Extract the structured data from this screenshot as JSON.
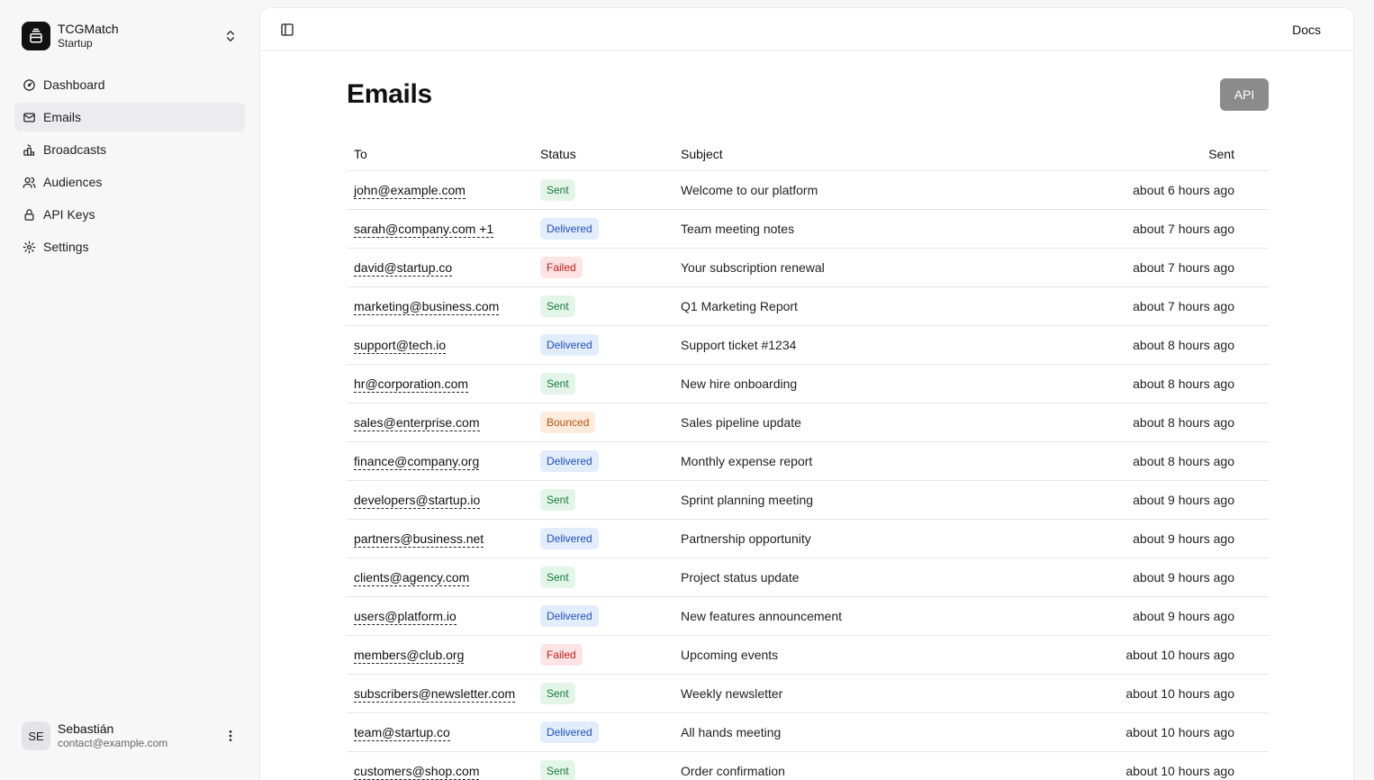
{
  "org": {
    "name": "TCGMatch",
    "plan": "Startup"
  },
  "nav": [
    {
      "label": "Dashboard",
      "icon": "gauge-icon",
      "active": false
    },
    {
      "label": "Emails",
      "icon": "mail-icon",
      "active": true
    },
    {
      "label": "Broadcasts",
      "icon": "megaphone-icon",
      "active": false
    },
    {
      "label": "Audiences",
      "icon": "users-icon",
      "active": false
    },
    {
      "label": "API Keys",
      "icon": "lock-icon",
      "active": false
    },
    {
      "label": "Settings",
      "icon": "gear-icon",
      "active": false
    }
  ],
  "user": {
    "initials": "SE",
    "name": "Sebastián",
    "email": "contact@example.com"
  },
  "topbar": {
    "docs_label": "Docs"
  },
  "page": {
    "title": "Emails",
    "api_label": "API"
  },
  "table": {
    "headers": {
      "to": "To",
      "status": "Status",
      "subject": "Subject",
      "sent": "Sent"
    },
    "rows": [
      {
        "to": "john@example.com",
        "status": "Sent",
        "subject": "Welcome to our platform",
        "sent": "about 6 hours ago"
      },
      {
        "to": "sarah@company.com +1",
        "status": "Delivered",
        "subject": "Team meeting notes",
        "sent": "about 7 hours ago"
      },
      {
        "to": "david@startup.co",
        "status": "Failed",
        "subject": "Your subscription renewal",
        "sent": "about 7 hours ago"
      },
      {
        "to": "marketing@business.com",
        "status": "Sent",
        "subject": "Q1 Marketing Report",
        "sent": "about 7 hours ago"
      },
      {
        "to": "support@tech.io",
        "status": "Delivered",
        "subject": "Support ticket #1234",
        "sent": "about 8 hours ago"
      },
      {
        "to": "hr@corporation.com",
        "status": "Sent",
        "subject": "New hire onboarding",
        "sent": "about 8 hours ago"
      },
      {
        "to": "sales@enterprise.com",
        "status": "Bounced",
        "subject": "Sales pipeline update",
        "sent": "about 8 hours ago"
      },
      {
        "to": "finance@company.org",
        "status": "Delivered",
        "subject": "Monthly expense report",
        "sent": "about 8 hours ago"
      },
      {
        "to": "developers@startup.io",
        "status": "Sent",
        "subject": "Sprint planning meeting",
        "sent": "about 9 hours ago"
      },
      {
        "to": "partners@business.net",
        "status": "Delivered",
        "subject": "Partnership opportunity",
        "sent": "about 9 hours ago"
      },
      {
        "to": "clients@agency.com",
        "status": "Sent",
        "subject": "Project status update",
        "sent": "about 9 hours ago"
      },
      {
        "to": "users@platform.io",
        "status": "Delivered",
        "subject": "New features announcement",
        "sent": "about 9 hours ago"
      },
      {
        "to": "members@club.org",
        "status": "Failed",
        "subject": "Upcoming events",
        "sent": "about 10 hours ago"
      },
      {
        "to": "subscribers@newsletter.com",
        "status": "Sent",
        "subject": "Weekly newsletter",
        "sent": "about 10 hours ago"
      },
      {
        "to": "team@startup.co",
        "status": "Delivered",
        "subject": "All hands meeting",
        "sent": "about 10 hours ago"
      },
      {
        "to": "customers@shop.com",
        "status": "Sent",
        "subject": "Order confirmation",
        "sent": "about 10 hours ago"
      }
    ]
  },
  "status_colors": {
    "Sent": "#157a3a",
    "Delivered": "#1e4fc4",
    "Failed": "#c21b1b",
    "Bounced": "#b9530c"
  }
}
